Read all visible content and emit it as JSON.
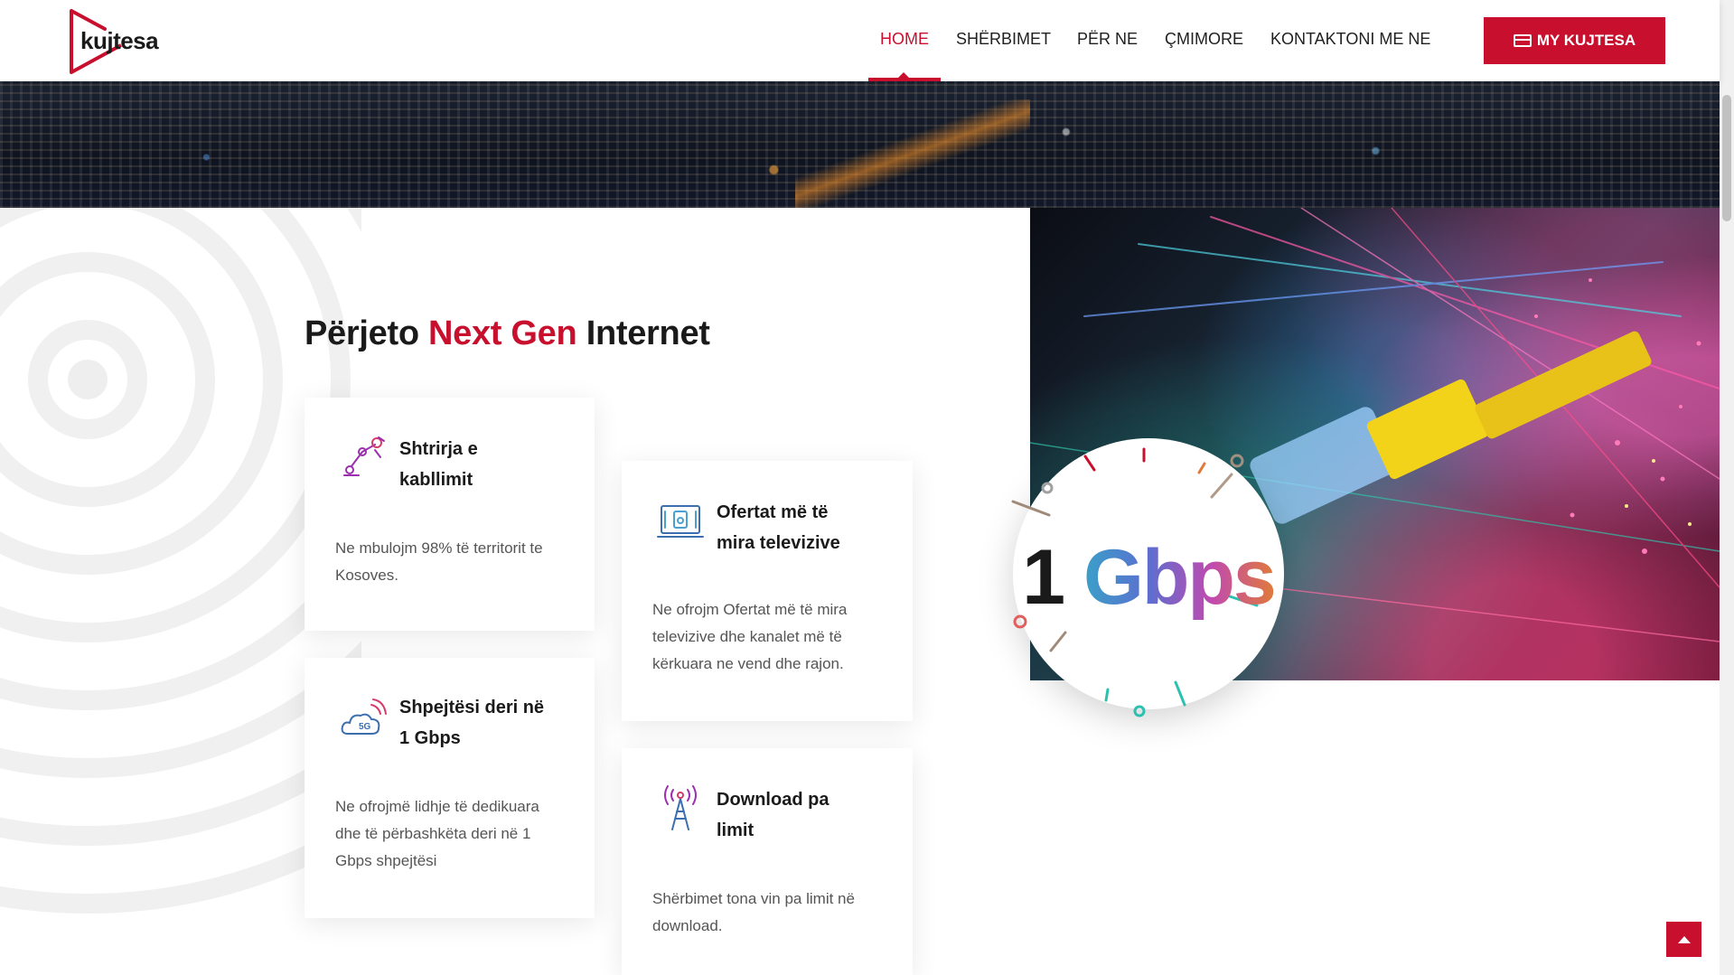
{
  "brand": {
    "logo_text": "kujtesa",
    "accent": "#c8102e"
  },
  "nav": {
    "items": [
      {
        "label": "HOME",
        "active": true
      },
      {
        "label": "SHËRBIMET",
        "active": false
      },
      {
        "label": "PËR NE",
        "active": false
      },
      {
        "label": "ÇMIMORE",
        "active": false
      },
      {
        "label": "KONTAKTONI ME NE",
        "active": false
      }
    ],
    "cta_label": "MY KUJTESA",
    "cta_icon": "card-icon"
  },
  "section": {
    "headline_pre": "Përjeto",
    "headline_highlight": "Next Gen",
    "headline_post": "Internet",
    "cards": [
      {
        "icon": "cable-robot-arm-icon",
        "title_1": "Shtrirja e",
        "title_2": "kabllimit",
        "text": [
          "Ne mbulojm 98% të territorit te",
          "Kosoves."
        ]
      },
      {
        "icon": "tv-laptop-icon",
        "title_1": "Ofertat më të",
        "title_2": "mira televizive",
        "text": [
          "Ne ofrojm Ofertat më të mira",
          "televizive dhe kanalet më të",
          "kërkuara ne vend dhe rajon."
        ]
      },
      {
        "icon": "5g-cloud-icon",
        "title_1": "Shpejtësi deri në",
        "title_2": "1 Gbps",
        "text": [
          "Ne ofrojmë lidhje të dedikuara",
          "dhe të përbashkëta deri në 1",
          "Gbps shpejtësi"
        ]
      },
      {
        "icon": "antenna-tower-icon",
        "title_1": "Download pa",
        "title_2": "limit",
        "text": [
          "Shërbimet tona vin pa limit në",
          "download."
        ]
      }
    ],
    "badge_number": "1",
    "badge_unit": "Gbps"
  }
}
